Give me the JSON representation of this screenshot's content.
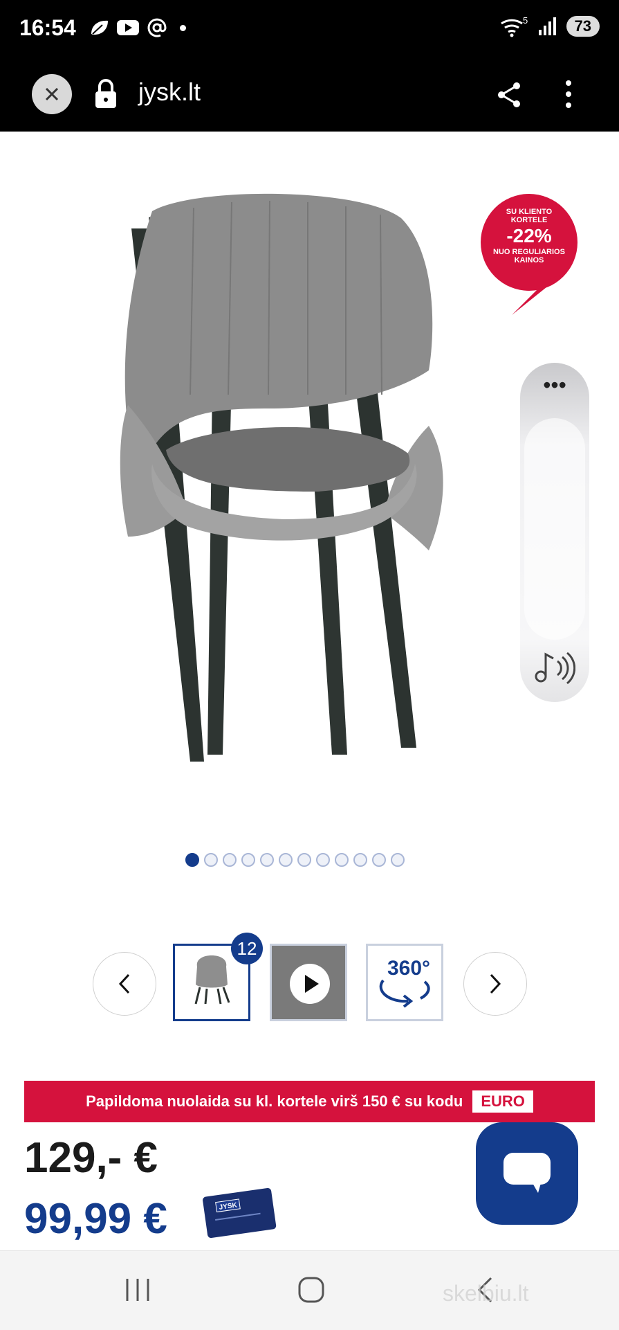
{
  "status_bar": {
    "time": "16:54",
    "battery": "73",
    "network": "5"
  },
  "browser": {
    "url": "jysk.lt"
  },
  "promo_badge": {
    "line1": "SU KLIENTO",
    "line2": "KORTELE",
    "discount": "-22%",
    "line3": "NUO REGULIARIOS",
    "line4": "KAINOS"
  },
  "carousel": {
    "image_count": 12,
    "active_index": 0
  },
  "thumbnails": {
    "count_badge": "12",
    "rotate_label": "360°"
  },
  "banner": {
    "text": "Papildoma nuolaida su kl. kortele virš 150 € su kodu",
    "code": "EURO"
  },
  "prices": {
    "regular": "129,-  €",
    "card": "99,99 €"
  },
  "card_logo": "JYSK",
  "watermark": "skelbiu.lt",
  "colors": {
    "brand_blue": "#143c8c",
    "promo_red": "#d5123d"
  }
}
